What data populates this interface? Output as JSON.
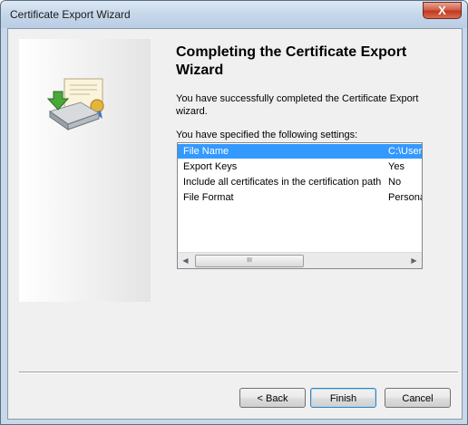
{
  "window": {
    "title": "Certificate Export Wizard",
    "close_glyph": "X"
  },
  "wizard": {
    "heading_line1": "Completing the Certificate Export",
    "heading_line2": "Wizard",
    "description": "You have successfully completed the Certificate Export wizard.",
    "settings_label": "You have specified the following settings:"
  },
  "settings": [
    {
      "name": "File Name",
      "value": "C:\\User",
      "selected": true
    },
    {
      "name": "Export Keys",
      "value": "Yes"
    },
    {
      "name": "Include all certificates in the certification path",
      "value": "No"
    },
    {
      "name": "File Format",
      "value": "Persona"
    }
  ],
  "scrollbar": {
    "left_glyph": "◀",
    "right_glyph": "▶",
    "grip_glyph": "III"
  },
  "buttons": {
    "back_label": "< Back",
    "finish_label": "Finish",
    "cancel_label": "Cancel"
  },
  "colors": {
    "selection": "#3399ff",
    "close_button": "#c0391f"
  },
  "icons": {
    "wizard_graphic": "certificate-export-icon"
  }
}
